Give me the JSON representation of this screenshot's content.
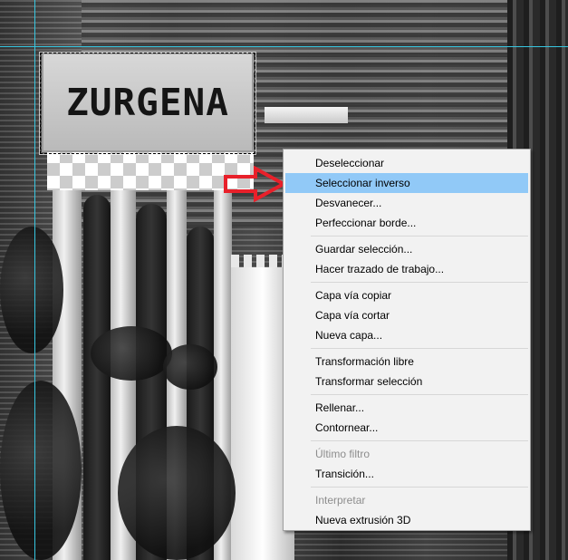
{
  "canvas": {
    "sign_text": "ZURGENA"
  },
  "guide_color": "#37c6e0",
  "arrow_color": "#e8202a",
  "context_menu": {
    "groups": [
      {
        "items": [
          {
            "label": "Deseleccionar",
            "state": "normal"
          },
          {
            "label": "Seleccionar inverso",
            "state": "highlighted"
          },
          {
            "label": "Desvanecer...",
            "state": "normal"
          },
          {
            "label": "Perfeccionar borde...",
            "state": "normal"
          }
        ]
      },
      {
        "items": [
          {
            "label": "Guardar selección...",
            "state": "normal"
          },
          {
            "label": "Hacer trazado de trabajo...",
            "state": "normal"
          }
        ]
      },
      {
        "items": [
          {
            "label": "Capa vía copiar",
            "state": "normal"
          },
          {
            "label": "Capa vía cortar",
            "state": "normal"
          },
          {
            "label": "Nueva capa...",
            "state": "normal"
          }
        ]
      },
      {
        "items": [
          {
            "label": "Transformación libre",
            "state": "normal"
          },
          {
            "label": "Transformar selección",
            "state": "normal"
          }
        ]
      },
      {
        "items": [
          {
            "label": "Rellenar...",
            "state": "normal"
          },
          {
            "label": "Contornear...",
            "state": "normal"
          }
        ]
      },
      {
        "items": [
          {
            "label": "Último filtro",
            "state": "disabled"
          },
          {
            "label": "Transición...",
            "state": "normal"
          }
        ]
      },
      {
        "items": [
          {
            "label": "Interpretar",
            "state": "disabled"
          },
          {
            "label": "Nueva extrusión 3D",
            "state": "normal"
          }
        ]
      }
    ],
    "highlight_color": "#91c9f7"
  }
}
